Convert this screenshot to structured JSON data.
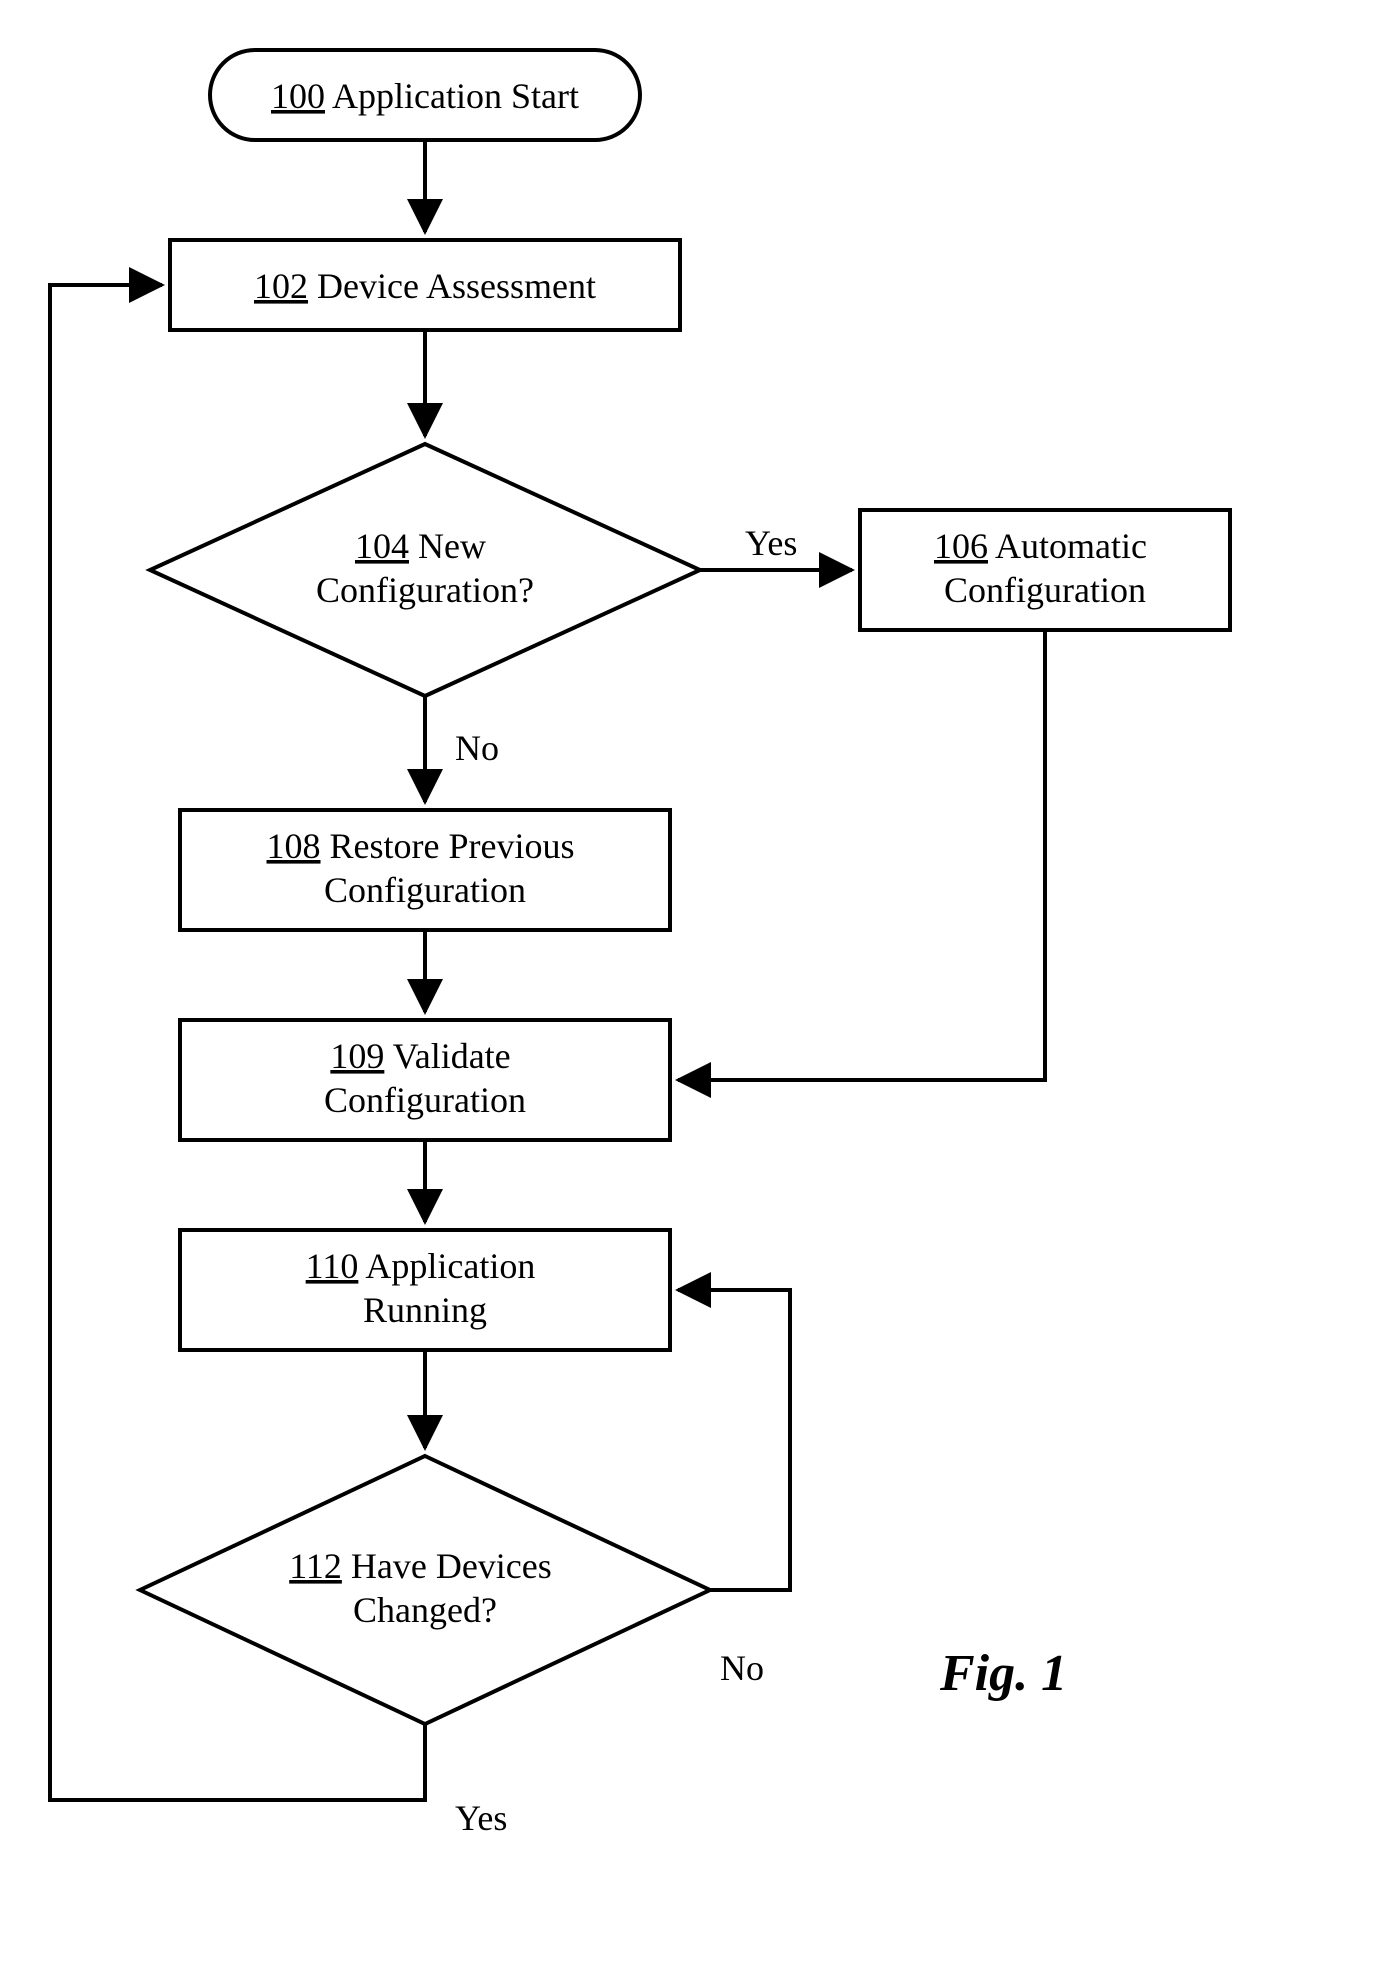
{
  "nodes": {
    "n100": {
      "ref": "100",
      "text": "Application Start"
    },
    "n102": {
      "ref": "102",
      "text": "Device Assessment"
    },
    "n104": {
      "ref": "104",
      "text1": "New",
      "text2": "Configuration?"
    },
    "n106": {
      "ref": "106",
      "text1": "Automatic",
      "text2": "Configuration"
    },
    "n108": {
      "ref": "108",
      "text1": "Restore Previous",
      "text2": "Configuration"
    },
    "n109": {
      "ref": "109",
      "text1": "Validate",
      "text2": "Configuration"
    },
    "n110": {
      "ref": "110",
      "text1": "Application",
      "text2": "Running"
    },
    "n112": {
      "ref": "112",
      "text1": "Have Devices",
      "text2": "Changed?"
    }
  },
  "edges": {
    "e104yes": "Yes",
    "e104no": "No",
    "e112no": "No",
    "e112yes": "Yes"
  },
  "figure": "Fig. 1"
}
